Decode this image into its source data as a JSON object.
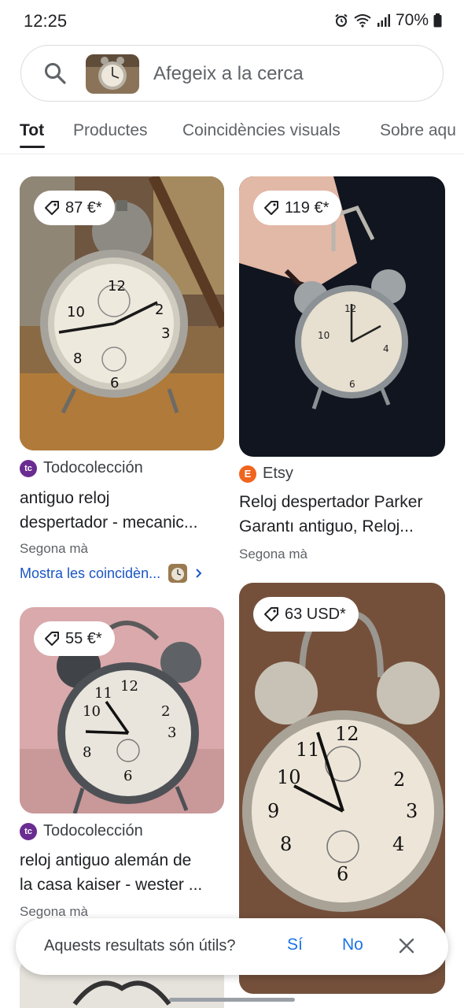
{
  "status_bar": {
    "time": "12:25",
    "battery": "70%"
  },
  "search": {
    "placeholder": "Afegeix a la cerca"
  },
  "tabs": [
    {
      "label": "Tot",
      "active": true
    },
    {
      "label": "Productes"
    },
    {
      "label": "Coincidències visuals"
    },
    {
      "label": "Sobre aqu"
    }
  ],
  "results": [
    {
      "price": "87 €*",
      "source": "Todocolección",
      "title_line1": "antiguo reloj",
      "title_line2": "despertador - mecanic...",
      "condition": "Segona mà",
      "more_matches": "Mostra les coincidèn..."
    },
    {
      "price": "119 €*",
      "source": "Etsy",
      "title_line1": "Reloj despertador Parker",
      "title_line2": "Garantı antiguo, Reloj...",
      "condition": "Segona mà"
    },
    {
      "price": "55 €*",
      "source": "Todocolección",
      "title_line1": "reloj antiguo alemán de",
      "title_line2": "la casa kaiser - wester ...",
      "condition": "Segona mà"
    },
    {
      "price": "63 USD*"
    }
  ],
  "feedback": {
    "question": "Aquests resultats són útils?",
    "yes": "Sí",
    "no": "No"
  },
  "colors": {
    "link": "#1a56c4",
    "accent": "#1a73e8",
    "todocoleccion": "#6a2c91",
    "etsy": "#f1641e"
  }
}
